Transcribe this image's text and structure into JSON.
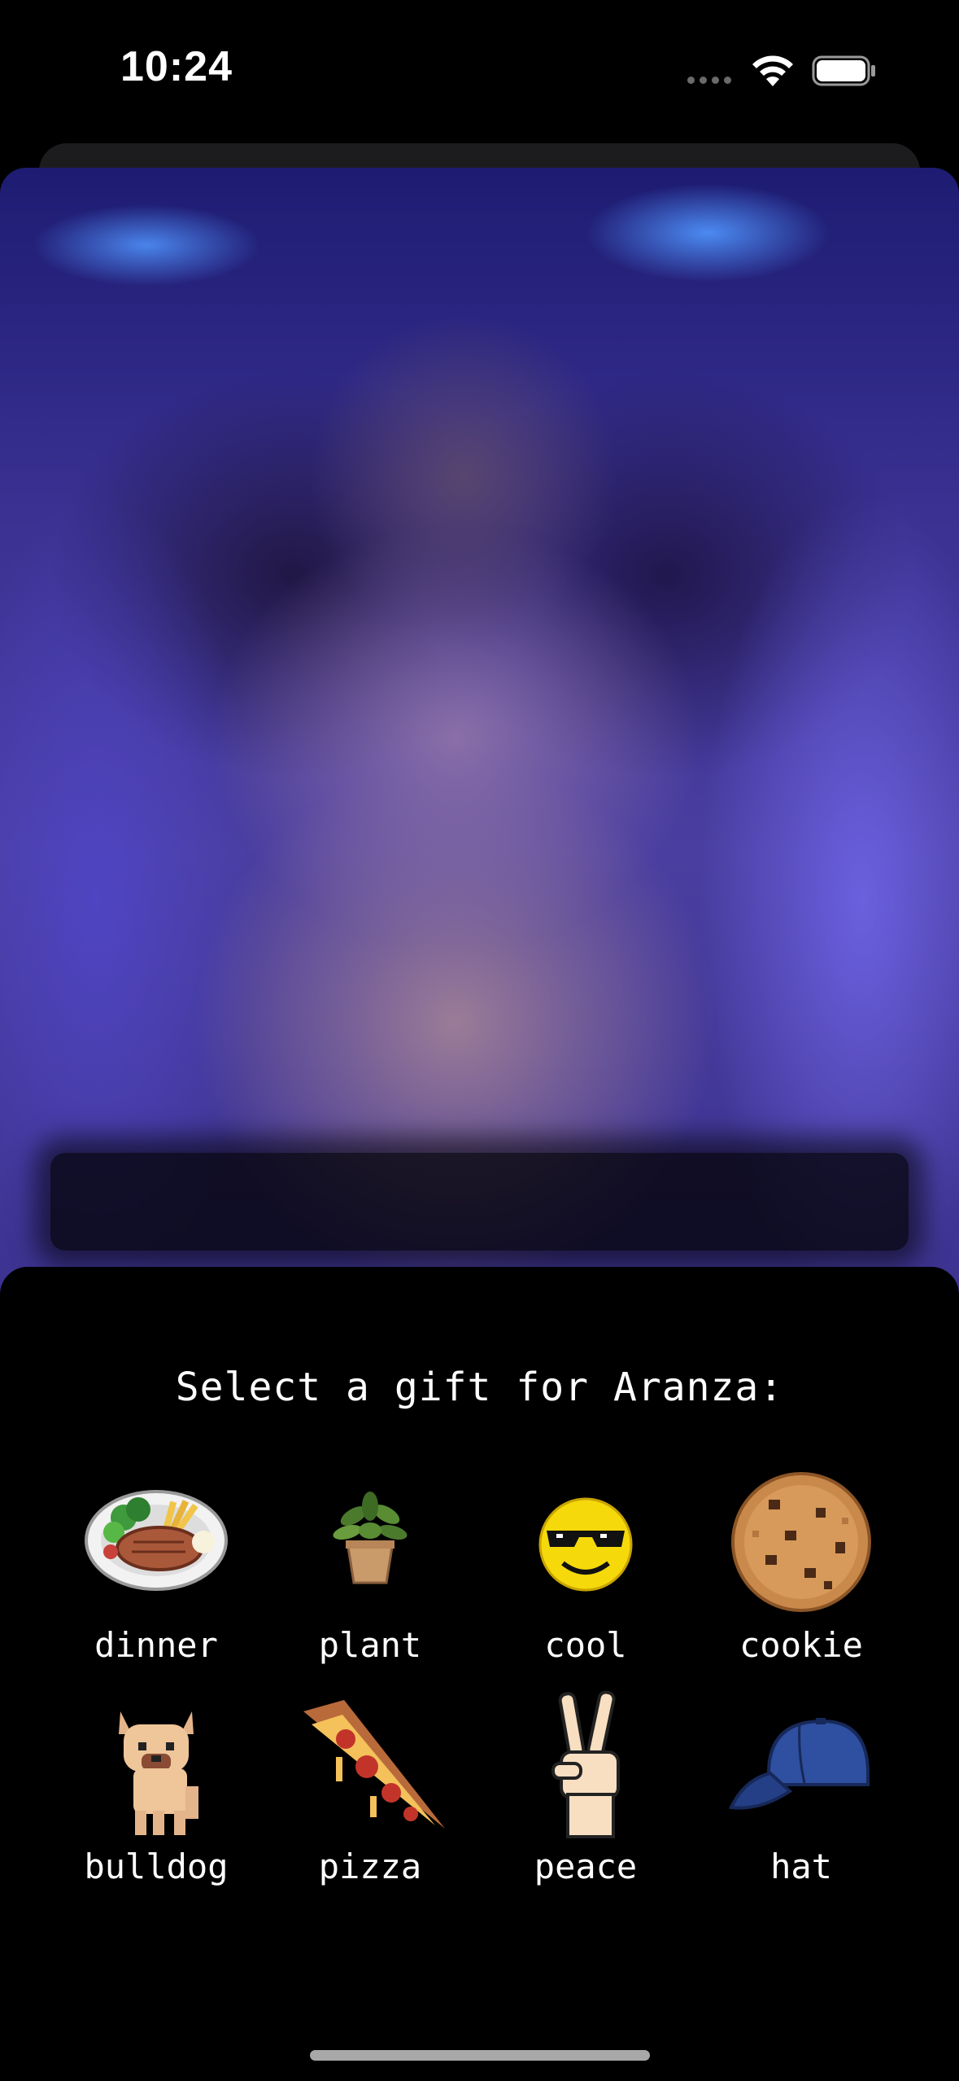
{
  "status_bar": {
    "time": "10:24"
  },
  "sheet": {
    "title": "Select a gift for Aranza:",
    "gifts": [
      {
        "label": "dinner",
        "icon": "dinner-plate-icon"
      },
      {
        "label": "plant",
        "icon": "potted-plant-icon"
      },
      {
        "label": "cool",
        "icon": "sunglasses-smiley-icon"
      },
      {
        "label": "cookie",
        "icon": "cookie-icon"
      },
      {
        "label": "bulldog",
        "icon": "bulldog-icon"
      },
      {
        "label": "pizza",
        "icon": "pizza-slice-icon"
      },
      {
        "label": "peace",
        "icon": "peace-hand-icon"
      },
      {
        "label": "hat",
        "icon": "cap-icon"
      }
    ]
  }
}
